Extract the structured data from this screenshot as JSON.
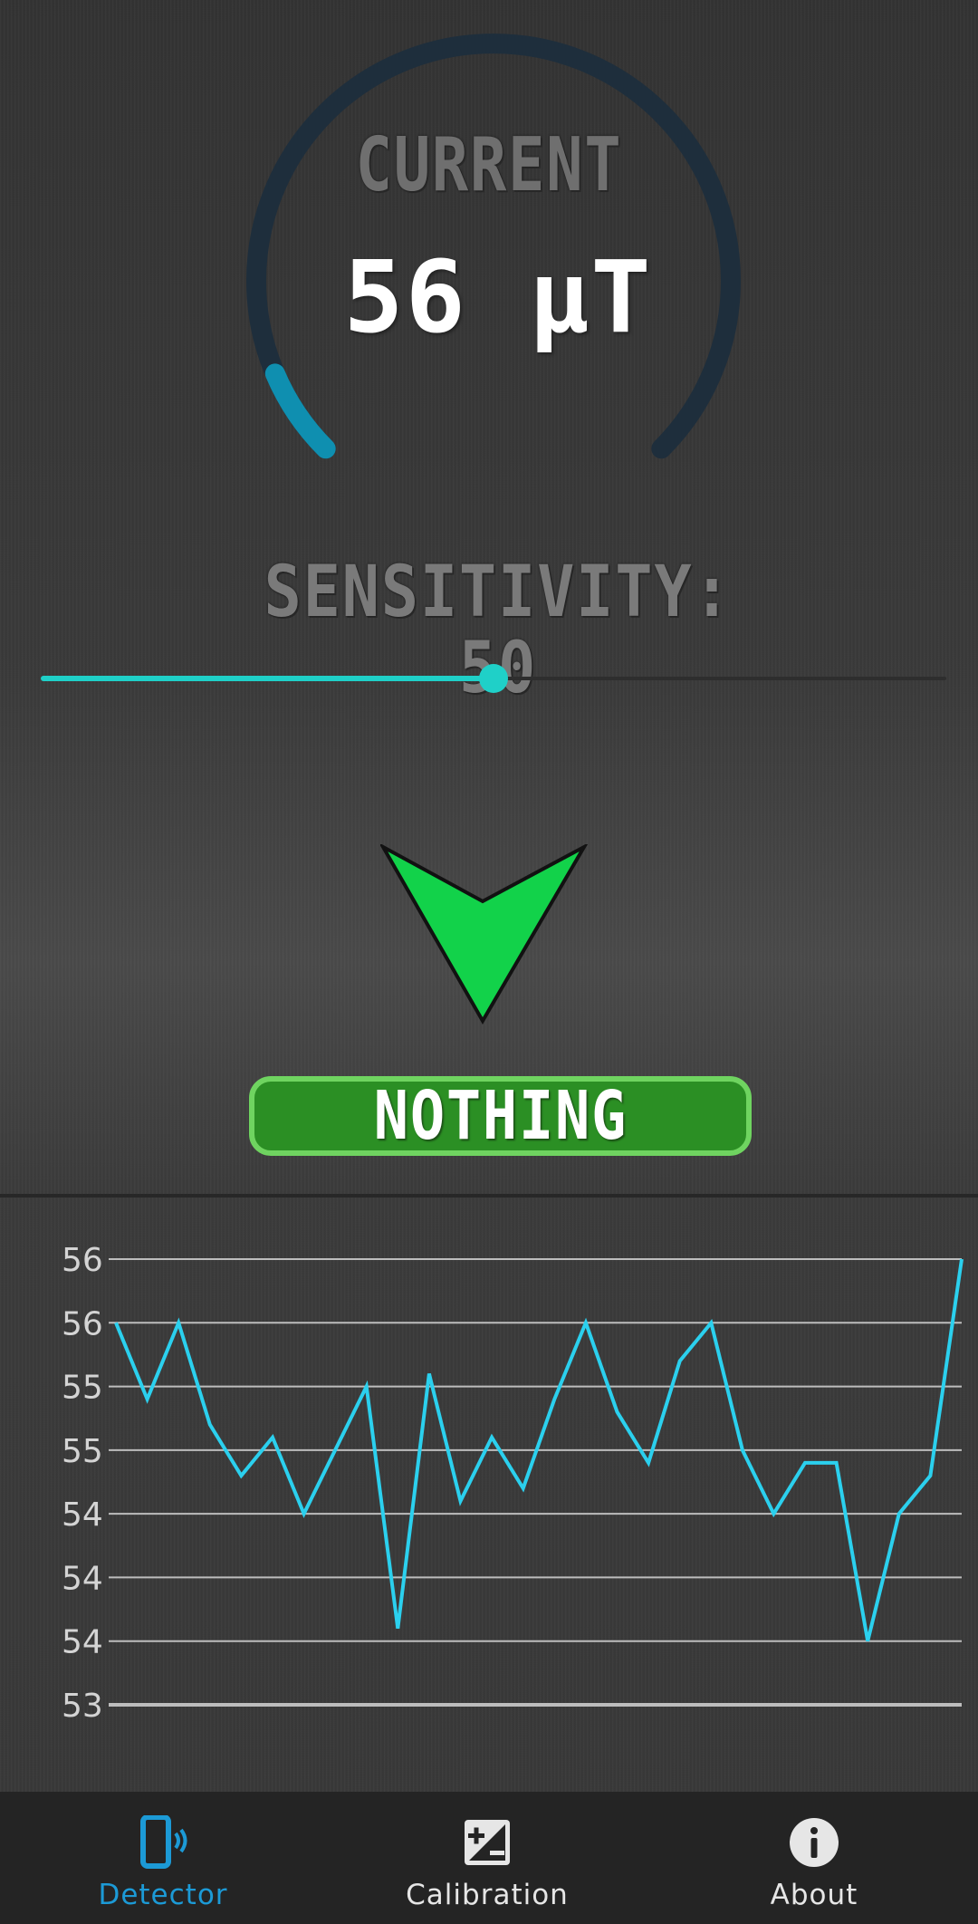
{
  "gauge": {
    "label": "CURRENT",
    "value": "56 μT",
    "accent_color": "#0f8fb0",
    "track_color": "#1e2e3c"
  },
  "sensitivity": {
    "label": "SENSITIVITY: 50",
    "value": 50,
    "max": 100,
    "color": "#1fd0c8"
  },
  "indicator": {
    "icon": "down-arrow-icon",
    "color": "#12d24a",
    "status": "NOTHING"
  },
  "chart_data": {
    "type": "line",
    "y_tick_labels": [
      "56",
      "56",
      "55",
      "55",
      "54",
      "54",
      "54",
      "53"
    ],
    "ylim": [
      53.0,
      56.5
    ],
    "grid": true,
    "series": [
      {
        "color": "#2bd0ee",
        "values": [
          56.0,
          55.4,
          56.0,
          55.2,
          54.8,
          55.1,
          54.5,
          55.0,
          55.5,
          53.6,
          55.6,
          54.6,
          55.1,
          54.7,
          55.4,
          56.0,
          55.3,
          54.9,
          55.7,
          56.0,
          55.0,
          54.5,
          54.9,
          54.9,
          53.5,
          54.5,
          54.8,
          56.5
        ]
      }
    ]
  },
  "nav": {
    "items": [
      {
        "label": "Detector",
        "icon": "phone-vibrate-icon",
        "active": true
      },
      {
        "label": "Calibration",
        "icon": "calibration-icon",
        "active": false
      },
      {
        "label": "About",
        "icon": "info-icon",
        "active": false
      }
    ],
    "active_color": "#1c9ad6",
    "inactive_color": "#e6e6e6"
  }
}
